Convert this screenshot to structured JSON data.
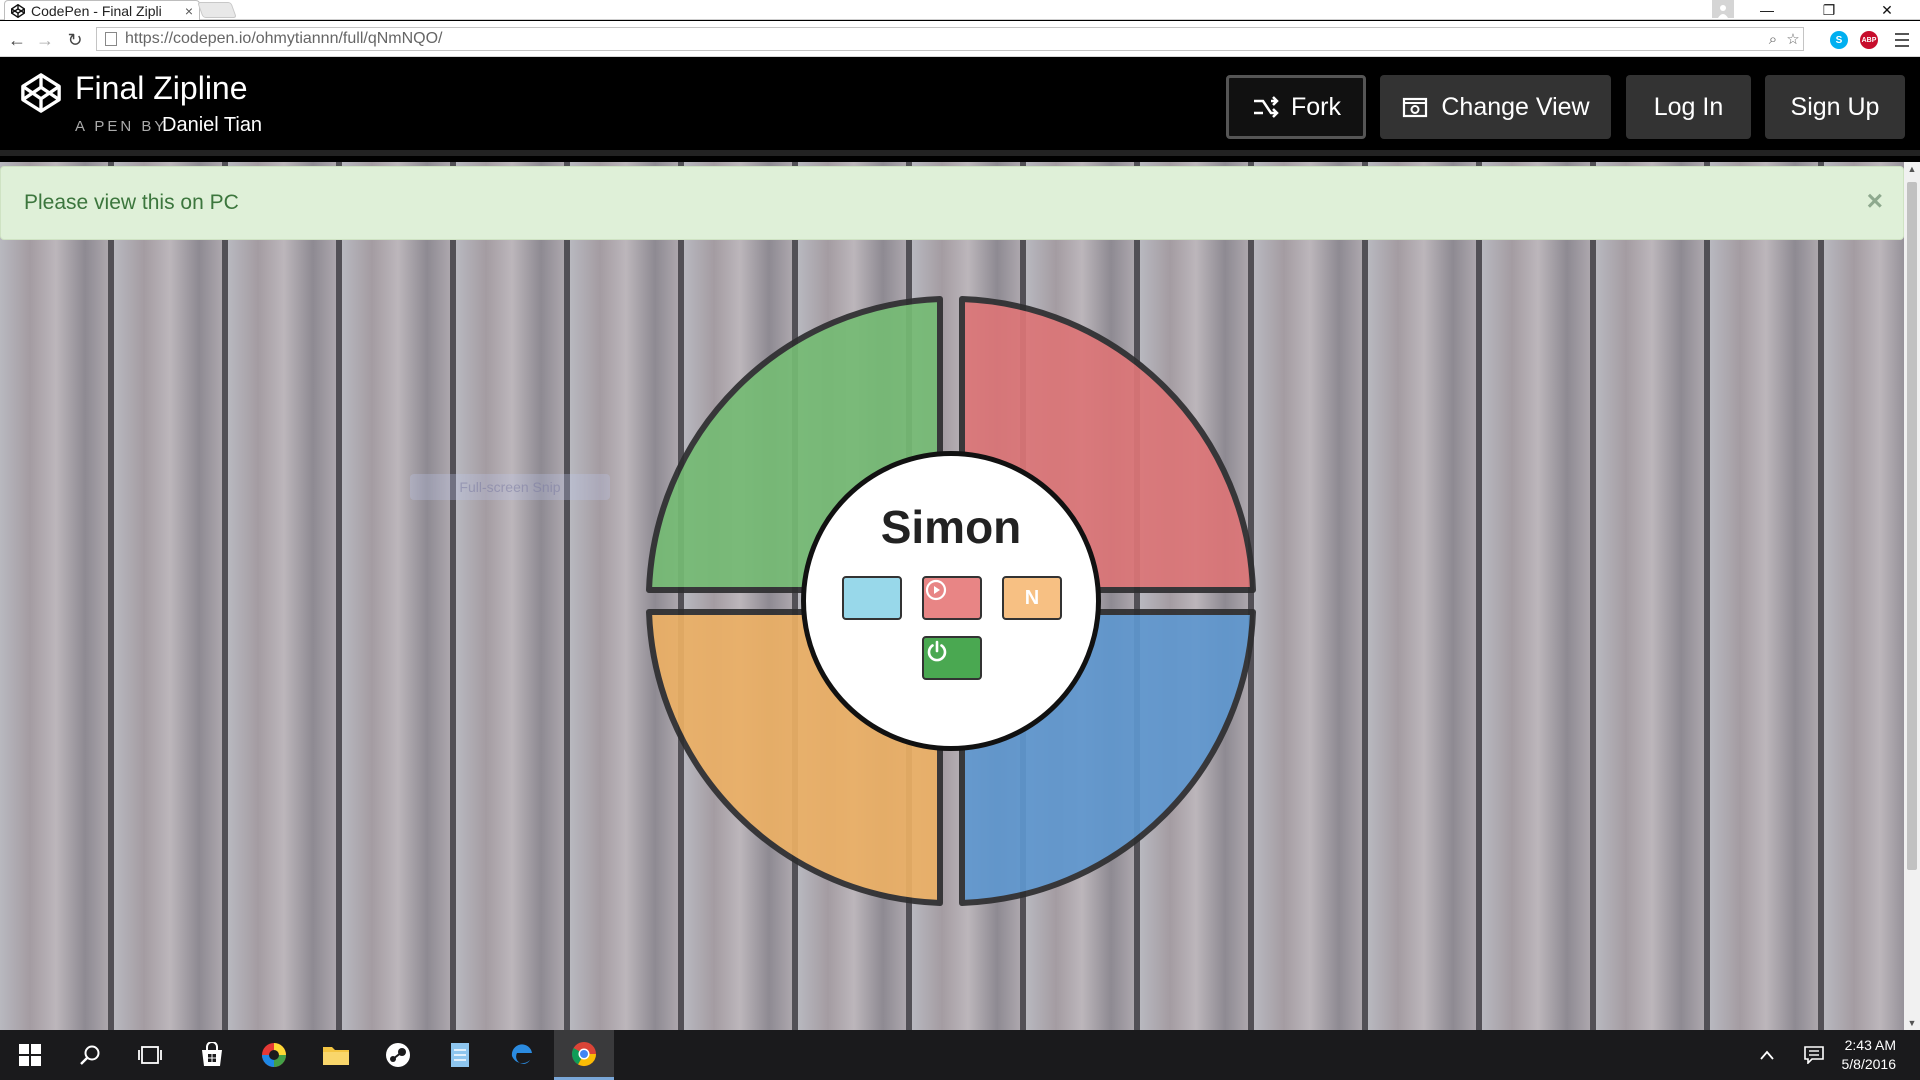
{
  "browser": {
    "tab_title": "CodePen - Final Zipli",
    "tab_close": "×",
    "url": "https://codepen.io/ohmytiannn/full/qNmNQO/",
    "window_controls": {
      "minimize": "—",
      "maximize": "❐",
      "close": "✕"
    },
    "extensions": [
      {
        "name": "skype-extension-icon",
        "label": "S",
        "color": "#00aff0"
      },
      {
        "name": "adblock-plus-icon",
        "label": "ABP",
        "color": "#c70d2c"
      }
    ]
  },
  "codepen": {
    "title": "Final Zipline",
    "by_label": "A PEN BY",
    "author": "Daniel Tian",
    "buttons": {
      "fork": "Fork",
      "change_view": "Change View",
      "login": "Log In",
      "signup": "Sign Up"
    }
  },
  "alert": {
    "message": "Please view this on PC",
    "close": "×"
  },
  "ghost_tooltip": "Full-screen Snip",
  "simon": {
    "title": "Simon",
    "count_button": "",
    "strict_button": "N",
    "colors": {
      "green": "#75bb74",
      "red": "#dc7577",
      "yellow": "#ecb065",
      "blue": "#5f97cf"
    }
  },
  "taskbar": {
    "time": "2:43 AM",
    "date": "5/8/2016"
  }
}
